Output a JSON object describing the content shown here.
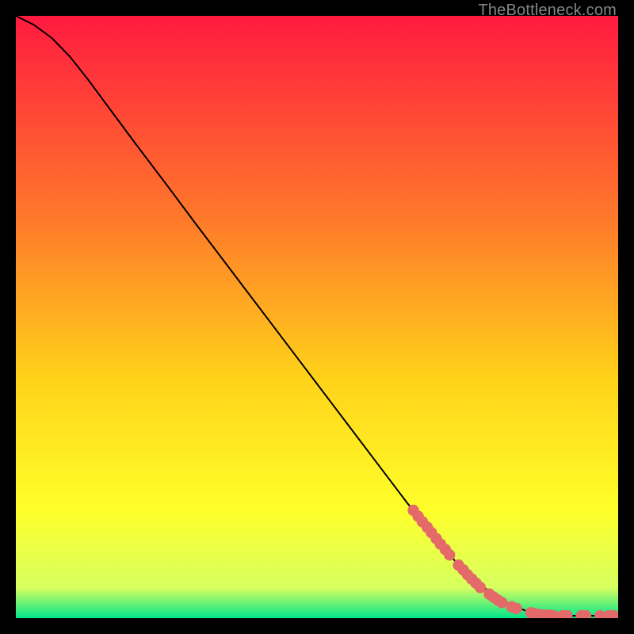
{
  "attribution": "TheBottleneck.com",
  "colors": {
    "bg": "#000000",
    "gradient_top": "#ff1a40",
    "gradient_mid1": "#ff7a2a",
    "gradient_mid2": "#ffd21a",
    "gradient_mid3": "#ffff2a",
    "gradient_low": "#d6ff60",
    "gradient_bottom": "#00e58a",
    "curve": "#000000",
    "marker": "#e46a6a",
    "attrib_text": "#858585"
  },
  "chart_data": {
    "type": "line",
    "title": "",
    "xlabel": "",
    "ylabel": "",
    "xlim": [
      0,
      100
    ],
    "ylim": [
      0,
      100
    ],
    "series": [
      {
        "name": "curve",
        "x": [
          0,
          3,
          6,
          9,
          12,
          16,
          20,
          25,
          30,
          35,
          40,
          45,
          50,
          55,
          60,
          65,
          70,
          73,
          76,
          79,
          82,
          85,
          86.5,
          88,
          90,
          92,
          94,
          96,
          98,
          100
        ],
        "y": [
          100,
          98.5,
          96.3,
          93.2,
          89.4,
          84.0,
          78.6,
          72.0,
          65.3,
          58.7,
          52.1,
          45.5,
          38.9,
          32.3,
          25.7,
          19.1,
          12.9,
          9.4,
          6.5,
          4.1,
          2.3,
          1.1,
          0.7,
          0.5,
          0.4,
          0.4,
          0.4,
          0.4,
          0.4,
          0.4
        ]
      }
    ],
    "markers": [
      {
        "x": 66.0,
        "y": 17.9
      },
      {
        "x": 66.8,
        "y": 16.9
      },
      {
        "x": 67.5,
        "y": 16.0
      },
      {
        "x": 68.3,
        "y": 15.1
      },
      {
        "x": 69.0,
        "y": 14.2
      },
      {
        "x": 69.8,
        "y": 13.2
      },
      {
        "x": 70.5,
        "y": 12.3
      },
      {
        "x": 71.3,
        "y": 11.4
      },
      {
        "x": 72.0,
        "y": 10.5
      },
      {
        "x": 73.5,
        "y": 8.8
      },
      {
        "x": 74.3,
        "y": 8.0
      },
      {
        "x": 75.0,
        "y": 7.2
      },
      {
        "x": 75.7,
        "y": 6.5
      },
      {
        "x": 76.4,
        "y": 5.8
      },
      {
        "x": 77.1,
        "y": 5.1
      },
      {
        "x": 78.6,
        "y": 4.0
      },
      {
        "x": 79.3,
        "y": 3.5
      },
      {
        "x": 80.0,
        "y": 3.0
      },
      {
        "x": 80.7,
        "y": 2.6
      },
      {
        "x": 82.3,
        "y": 1.9
      },
      {
        "x": 83.1,
        "y": 1.6
      },
      {
        "x": 85.5,
        "y": 0.9
      },
      {
        "x": 86.0,
        "y": 0.8
      },
      {
        "x": 87.0,
        "y": 0.6
      },
      {
        "x": 87.8,
        "y": 0.5
      },
      {
        "x": 88.6,
        "y": 0.5
      },
      {
        "x": 89.3,
        "y": 0.4
      },
      {
        "x": 90.8,
        "y": 0.4
      },
      {
        "x": 91.5,
        "y": 0.4
      },
      {
        "x": 93.9,
        "y": 0.4
      },
      {
        "x": 94.6,
        "y": 0.4
      },
      {
        "x": 97.0,
        "y": 0.4
      },
      {
        "x": 98.5,
        "y": 0.4
      },
      {
        "x": 99.2,
        "y": 0.4
      }
    ]
  }
}
